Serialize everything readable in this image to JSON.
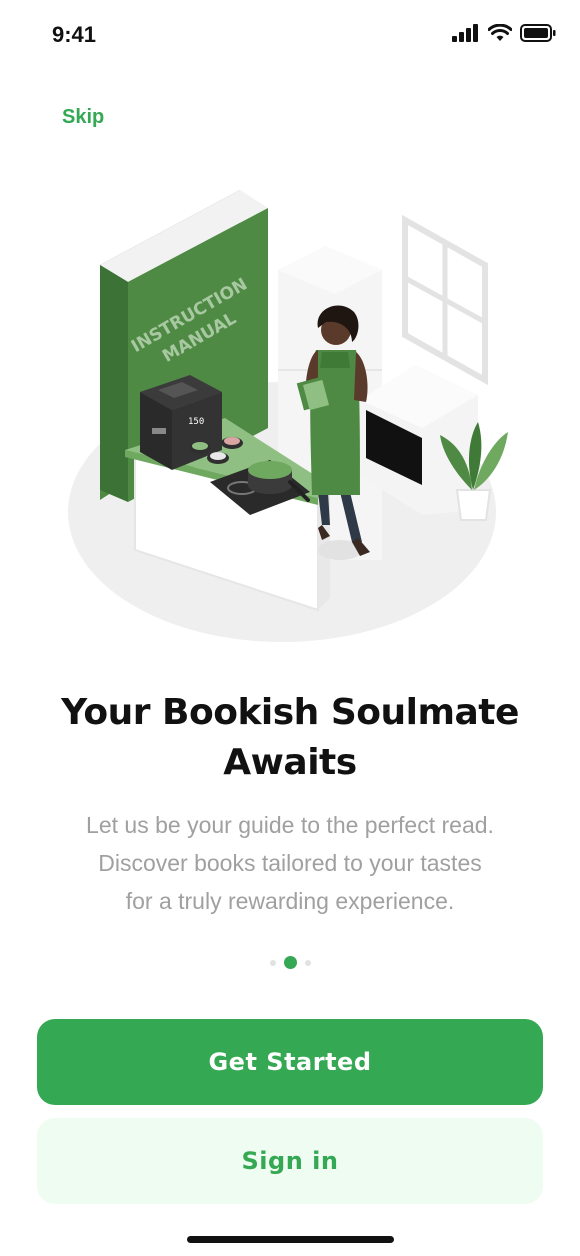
{
  "status_bar": {
    "time": "9:41",
    "icons": [
      "cellular-signal-icon",
      "wifi-icon",
      "battery-icon"
    ]
  },
  "header": {
    "skip_label": "Skip"
  },
  "illustration": {
    "book_text_line1": "INSTRUCTION",
    "book_text_line2": "MANUAL",
    "panel_digits": "150"
  },
  "onboarding": {
    "title_line1": "Your Bookish Soulmate",
    "title_line2": "Awaits",
    "subtitle_line1": "Let us be your guide to the perfect read.",
    "subtitle_line2": "Discover books tailored to your tastes",
    "subtitle_line3": "for a truly rewarding experience.",
    "page_count": 3,
    "active_page": 2
  },
  "actions": {
    "primary_label": "Get Started",
    "secondary_label": "Sign in"
  },
  "colors": {
    "accent": "#34a853",
    "accent_light": "#effcf1",
    "illustration_green": "#4f8a45",
    "text_primary": "#111111",
    "text_muted": "#a0a0a0"
  }
}
